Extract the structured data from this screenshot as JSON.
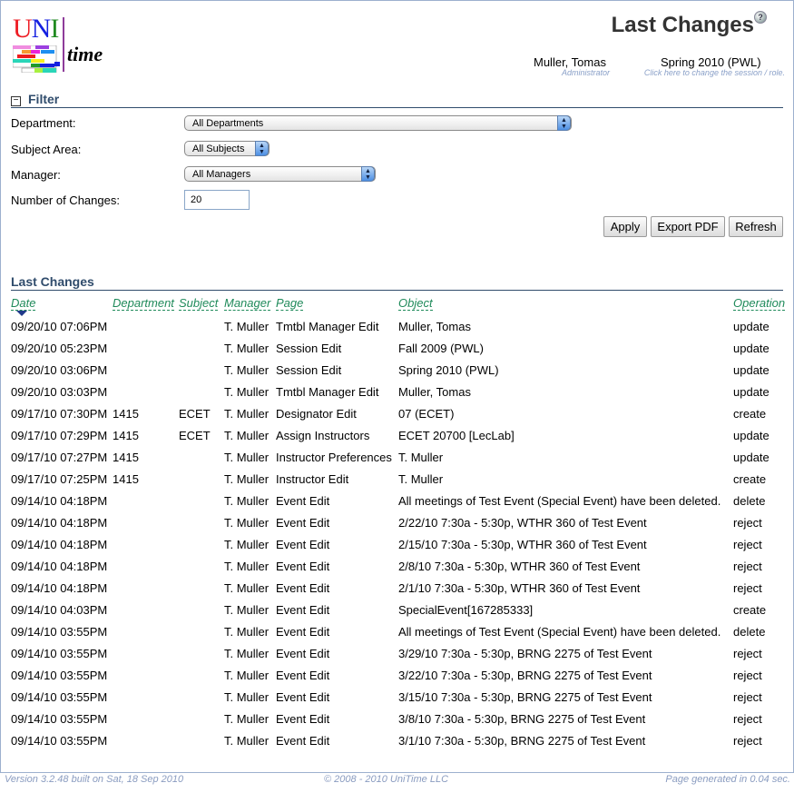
{
  "header": {
    "logo_text": [
      "U",
      "N",
      "I"
    ],
    "logo_subtext": "time",
    "page_title": "Last Changes",
    "help_icon": "help-icon",
    "user_name": "Muller, Tomas",
    "user_role": "Administrator",
    "session_name": "Spring 2010 (PWL)",
    "session_hint": "Click here to change the session / role."
  },
  "filter": {
    "title": "Filter",
    "collapse_icon": "−",
    "department_label": "Department:",
    "department_value": "All Departments",
    "subject_label": "Subject Area:",
    "subject_value": "All Subjects",
    "manager_label": "Manager:",
    "manager_value": "All Managers",
    "changes_label": "Number of Changes:",
    "changes_value": "20",
    "apply_label": "Apply",
    "export_label": "Export PDF",
    "refresh_label": "Refresh"
  },
  "changes": {
    "title": "Last Changes",
    "columns": {
      "date": "Date",
      "department": "Department",
      "subject": "Subject",
      "manager": "Manager",
      "page": "Page",
      "object": "Object",
      "operation": "Operation"
    },
    "sort_column": "Date",
    "rows": [
      {
        "date": "09/20/10 07:06PM",
        "department": "",
        "subject": "",
        "manager": "T. Muller",
        "page": "Tmtbl Manager Edit",
        "object": "Muller, Tomas",
        "operation": "update"
      },
      {
        "date": "09/20/10 05:23PM",
        "department": "",
        "subject": "",
        "manager": "T. Muller",
        "page": "Session Edit",
        "object": "Fall 2009 (PWL)",
        "operation": "update"
      },
      {
        "date": "09/20/10 03:06PM",
        "department": "",
        "subject": "",
        "manager": "T. Muller",
        "page": "Session Edit",
        "object": "Spring 2010 (PWL)",
        "operation": "update"
      },
      {
        "date": "09/20/10 03:03PM",
        "department": "",
        "subject": "",
        "manager": "T. Muller",
        "page": "Tmtbl Manager Edit",
        "object": "Muller, Tomas",
        "operation": "update"
      },
      {
        "date": "09/17/10 07:30PM",
        "department": "1415",
        "subject": "ECET",
        "manager": "T. Muller",
        "page": "Designator Edit",
        "object": "07 (ECET)",
        "operation": "create"
      },
      {
        "date": "09/17/10 07:29PM",
        "department": "1415",
        "subject": "ECET",
        "manager": "T. Muller",
        "page": "Assign Instructors",
        "object": "ECET 20700 [LecLab]",
        "operation": "update"
      },
      {
        "date": "09/17/10 07:27PM",
        "department": "1415",
        "subject": "",
        "manager": "T. Muller",
        "page": "Instructor Preferences",
        "object": "T. Muller",
        "operation": "update"
      },
      {
        "date": "09/17/10 07:25PM",
        "department": "1415",
        "subject": "",
        "manager": "T. Muller",
        "page": "Instructor Edit",
        "object": "T. Muller",
        "operation": "create"
      },
      {
        "date": "09/14/10 04:18PM",
        "department": "",
        "subject": "",
        "manager": "T. Muller",
        "page": "Event Edit",
        "object": "All meetings of Test Event (Special Event) have been deleted.",
        "operation": "delete"
      },
      {
        "date": "09/14/10 04:18PM",
        "department": "",
        "subject": "",
        "manager": "T. Muller",
        "page": "Event Edit",
        "object": "2/22/10 7:30a - 5:30p, WTHR 360 of Test Event",
        "operation": "reject"
      },
      {
        "date": "09/14/10 04:18PM",
        "department": "",
        "subject": "",
        "manager": "T. Muller",
        "page": "Event Edit",
        "object": "2/15/10 7:30a - 5:30p, WTHR 360 of Test Event",
        "operation": "reject"
      },
      {
        "date": "09/14/10 04:18PM",
        "department": "",
        "subject": "",
        "manager": "T. Muller",
        "page": "Event Edit",
        "object": "2/8/10 7:30a - 5:30p, WTHR 360 of Test Event",
        "operation": "reject"
      },
      {
        "date": "09/14/10 04:18PM",
        "department": "",
        "subject": "",
        "manager": "T. Muller",
        "page": "Event Edit",
        "object": "2/1/10 7:30a - 5:30p, WTHR 360 of Test Event",
        "operation": "reject"
      },
      {
        "date": "09/14/10 04:03PM",
        "department": "",
        "subject": "",
        "manager": "T. Muller",
        "page": "Event Edit",
        "object": "SpecialEvent[167285333]",
        "operation": "create"
      },
      {
        "date": "09/14/10 03:55PM",
        "department": "",
        "subject": "",
        "manager": "T. Muller",
        "page": "Event Edit",
        "object": "All meetings of Test Event (Special Event) have been deleted.",
        "operation": "delete"
      },
      {
        "date": "09/14/10 03:55PM",
        "department": "",
        "subject": "",
        "manager": "T. Muller",
        "page": "Event Edit",
        "object": "3/29/10 7:30a - 5:30p, BRNG 2275 of Test Event",
        "operation": "reject"
      },
      {
        "date": "09/14/10 03:55PM",
        "department": "",
        "subject": "",
        "manager": "T. Muller",
        "page": "Event Edit",
        "object": "3/22/10 7:30a - 5:30p, BRNG 2275 of Test Event",
        "operation": "reject"
      },
      {
        "date": "09/14/10 03:55PM",
        "department": "",
        "subject": "",
        "manager": "T. Muller",
        "page": "Event Edit",
        "object": "3/15/10 7:30a - 5:30p, BRNG 2275 of Test Event",
        "operation": "reject"
      },
      {
        "date": "09/14/10 03:55PM",
        "department": "",
        "subject": "",
        "manager": "T. Muller",
        "page": "Event Edit",
        "object": "3/8/10 7:30a - 5:30p, BRNG 2275 of Test Event",
        "operation": "reject"
      },
      {
        "date": "09/14/10 03:55PM",
        "department": "",
        "subject": "",
        "manager": "T. Muller",
        "page": "Event Edit",
        "object": "3/1/10 7:30a - 5:30p, BRNG 2275 of Test Event",
        "operation": "reject"
      }
    ]
  },
  "footer": {
    "version": "Version 3.2.48 built on Sat, 18 Sep 2010",
    "copyright": "© 2008 - 2010 UniTime LLC",
    "generated": "Page generated in 0.04 sec."
  },
  "colors": {
    "section_header": "#304c6c",
    "column_header": "#1f8a5a",
    "hint_text": "#8aa0c8"
  }
}
